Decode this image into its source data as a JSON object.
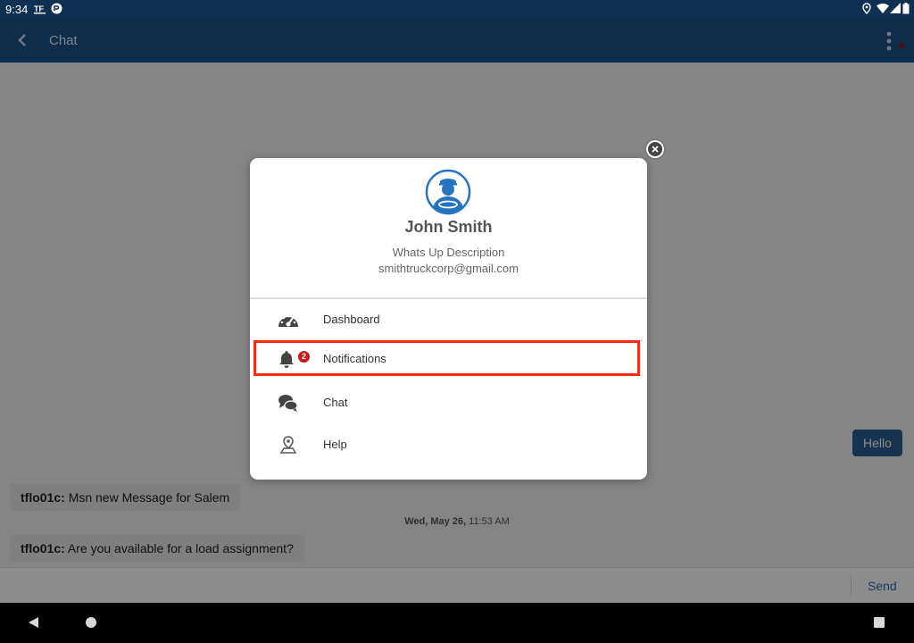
{
  "status_bar": {
    "time": "9:34",
    "left_icons": [
      "tf-app-icon",
      "circle-app-icon"
    ],
    "right_icons": [
      "location-icon",
      "wifi-icon",
      "signal-icon",
      "battery-icon"
    ]
  },
  "app_bar": {
    "title": "Chat",
    "back_icon": "back-chevron-icon",
    "menu_icon": "more-vert-icon",
    "color": "#1b5289"
  },
  "messages": [
    {
      "sender": "tflo01c:",
      "text": "Msn new Message for Salem"
    },
    {
      "sender": "tflo01c:",
      "text": "Are you available for a load assignment?"
    }
  ],
  "outgoing": [
    {
      "text": "Hello"
    }
  ],
  "date_label": {
    "date": "Wed, May 26,",
    "time": "11:53 AM"
  },
  "input": {
    "value": "",
    "placeholder": "",
    "send_label": "Send"
  },
  "profile": {
    "name": "John Smith",
    "description": "Whats Up Description",
    "email": "smithtruckcorp@gmail.com",
    "avatar_icon": "driver-avatar-icon"
  },
  "menu": [
    {
      "label": "Dashboard",
      "icon": "speedometer-icon"
    },
    {
      "label": "Notifications",
      "icon": "bell-icon",
      "badge": "2",
      "highlighted": true
    },
    {
      "label": "Chat",
      "icon": "chat-bubbles-icon"
    },
    {
      "label": "Help",
      "icon": "help-pin-icon"
    }
  ],
  "colors": {
    "accent": "#1b5289",
    "highlight_border": "#ff2a0e",
    "badge": "#cc1a1a",
    "send": "#2a6bb0"
  }
}
